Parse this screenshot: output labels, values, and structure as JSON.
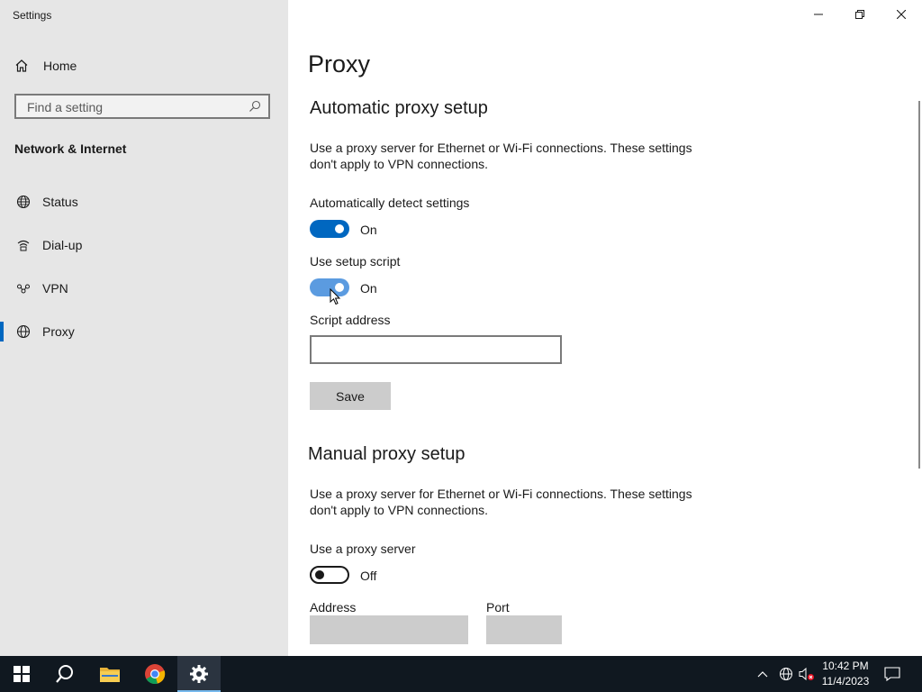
{
  "window": {
    "title": "Settings"
  },
  "sidebar": {
    "home_label": "Home",
    "search_placeholder": "Find a setting",
    "section_title": "Network & Internet",
    "items": [
      {
        "label": "Status",
        "icon": "globe-icon"
      },
      {
        "label": "Dial-up",
        "icon": "dialup-icon"
      },
      {
        "label": "VPN",
        "icon": "vpn-icon"
      },
      {
        "label": "Proxy",
        "icon": "globe-icon",
        "active": true
      }
    ]
  },
  "main": {
    "page_title": "Proxy",
    "automatic": {
      "heading": "Automatic proxy setup",
      "description": "Use a proxy server for Ethernet or Wi-Fi connections. These settings don't apply to VPN connections.",
      "detect_label": "Automatically detect settings",
      "detect_state": "On",
      "script_label": "Use setup script",
      "script_state": "On",
      "address_label": "Script address",
      "address_value": "",
      "save_label": "Save"
    },
    "manual": {
      "heading": "Manual proxy setup",
      "description": "Use a proxy server for Ethernet or Wi-Fi connections. These settings don't apply to VPN connections.",
      "use_proxy_label": "Use a proxy server",
      "use_proxy_state": "Off",
      "address_label": "Address",
      "port_label": "Port"
    }
  },
  "taskbar": {
    "time": "10:42 PM",
    "date": "11/4/2023"
  },
  "colors": {
    "accent": "#0067c0",
    "accent_light": "#5b9be0",
    "sidebar_bg": "#e6e6e6",
    "taskbar_bg": "#101820"
  }
}
